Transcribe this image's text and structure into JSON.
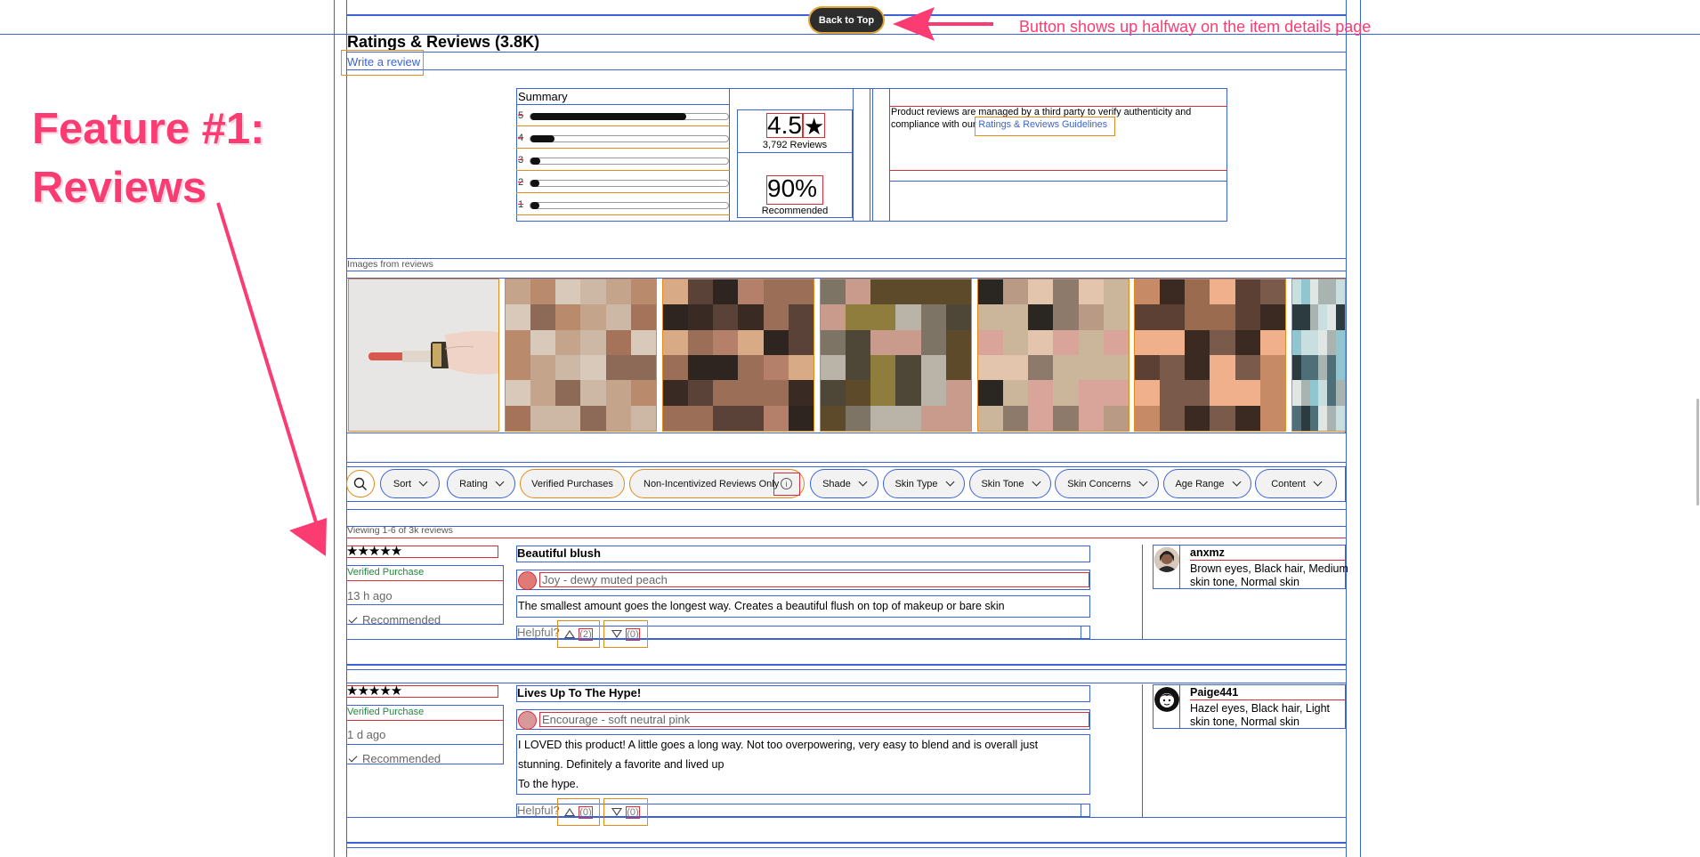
{
  "annotations": {
    "feature_title_line1": "Feature #1:",
    "feature_title_line2": "Reviews",
    "back_to_top_note": "Button shows up halfway on the item details page"
  },
  "back_to_top_label": "Back to Top",
  "reviews_section": {
    "title": "Ratings & Reviews (3.8K)",
    "write_review": "Write a review",
    "summary": {
      "label": "Summary",
      "star_rows": [
        {
          "label": "5",
          "fraction": 0.78
        },
        {
          "label": "4",
          "fraction": 0.12
        },
        {
          "label": "3",
          "fraction": 0.05
        },
        {
          "label": "2",
          "fraction": 0.03
        },
        {
          "label": "1",
          "fraction": 0.03
        }
      ],
      "average": "4.5",
      "average_star": "★",
      "review_count": "3,792 Reviews",
      "recommended_pct": "90%",
      "recommended_label": "Recommended"
    },
    "disclaimer_text": "Product reviews are managed by a third party to verify authenticity and compliance with our",
    "guidelines_link": "Ratings & Reviews Guidelines",
    "images_label": "Images from reviews",
    "filters": {
      "search_icon": "search-icon",
      "items": [
        "Sort",
        "Rating",
        "Verified Purchases",
        "Non-Incentivized Reviews Only",
        "Shade",
        "Skin Type",
        "Skin Tone",
        "Skin Concerns",
        "Age Range",
        "Content"
      ]
    },
    "viewing_text": "Viewing 1-6 of 3k reviews",
    "reviews": [
      {
        "stars": "★★★★★",
        "verified": "Verified Purchase",
        "time": "13 h ago",
        "recommended": "Recommended",
        "title": "Beautiful blush",
        "shade": "Joy - dewy muted peach",
        "shade_color": "#e07a74",
        "body": "The smallest amount goes the longest way. Creates a beautiful flush on top of makeup or bare skin",
        "helpful_label": "Helpful?",
        "helpful_up": "(2)",
        "helpful_down": "(0)",
        "author": "anxmz",
        "traits": "Brown eyes, Black hair, Medium skin tone, Normal skin"
      },
      {
        "stars": "★★★★★",
        "verified": "Verified Purchase",
        "time": "1 d ago",
        "recommended": "Recommended",
        "title": "Lives Up To The Hype!",
        "shade": "Encourage - soft neutral pink",
        "shade_color": "#d8999b",
        "body_line1": "I LOVED this product! A little goes a long way. Not too overpowering, very easy to blend and is overall just",
        "body_line2": "stunning. Definitely a favorite and lived up",
        "body_line3": "To the hype.",
        "helpful_label": "Helpful?",
        "helpful_up": "(0)",
        "helpful_down": "(0)",
        "author": "Paige441",
        "traits": "Hazel eyes, Black hair, Light skin tone, Normal skin"
      }
    ]
  },
  "colors": {
    "accent_pink": "#fa3c73",
    "outline_blue": "#3b63d6",
    "outline_red": "#d92e3a",
    "outline_orange": "#e68a1a",
    "verified_green": "#1d8a3a"
  }
}
